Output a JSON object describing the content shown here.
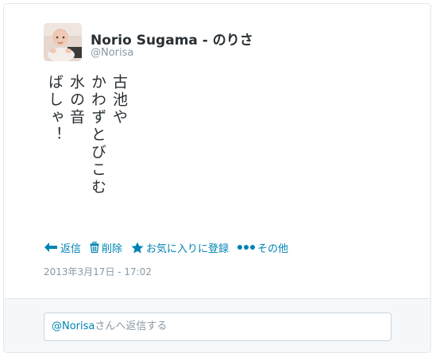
{
  "user": {
    "display_name": "Norio Sugama - のりさ",
    "screen_name": "@Norisa"
  },
  "tweet": {
    "lines": [
      "古池や",
      "かわずとびこむ",
      "水の音",
      "ばしゃ！"
    ],
    "timestamp": "2013年3月17日 - 17:02"
  },
  "actions": {
    "reply": {
      "label": "返信",
      "icon": "reply-arrow-icon"
    },
    "delete": {
      "label": "削除",
      "icon": "trash-icon"
    },
    "favorite": {
      "label": "お気に入りに登録",
      "icon": "star-icon"
    },
    "more": {
      "label": "その他",
      "icon": "ellipsis-icon"
    }
  },
  "reply": {
    "mention": "@Norisa",
    "placeholder_rest": "さんへ返信する"
  },
  "colors": {
    "link": "#0084b4",
    "muted": "#8899a6",
    "text": "#292f33"
  }
}
